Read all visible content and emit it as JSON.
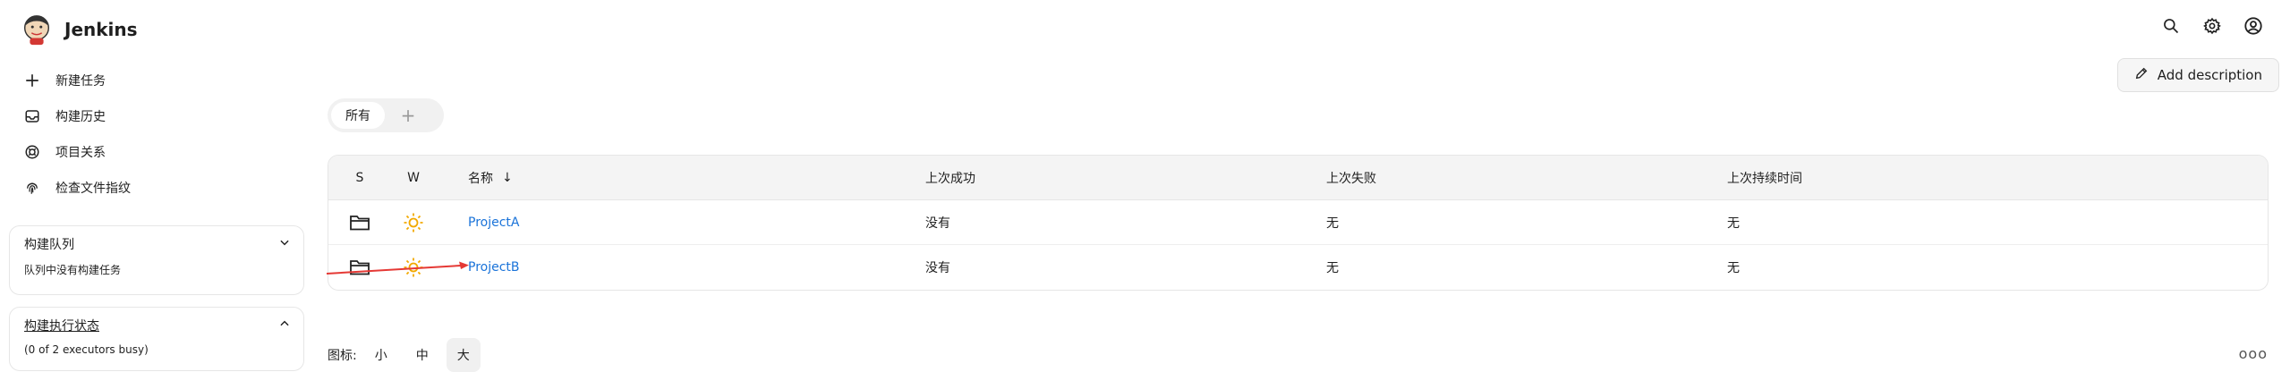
{
  "header": {
    "brand": "Jenkins",
    "icons": [
      "search-icon",
      "gear-icon",
      "user-icon"
    ]
  },
  "sidebar": {
    "tasks": [
      {
        "label": "新建任务",
        "icon": "plus-icon"
      },
      {
        "label": "构建历史",
        "icon": "inbox-icon"
      },
      {
        "label": "项目关系",
        "icon": "relationship-icon"
      },
      {
        "label": "检查文件指纹",
        "icon": "fingerprint-icon"
      }
    ],
    "queue": {
      "title": "构建队列",
      "empty_text": "队列中没有构建任务"
    },
    "executors": {
      "title": "构建执行状态",
      "status": "(0 of 2 executors busy)"
    }
  },
  "main": {
    "add_description": "Add description",
    "tabs": [
      {
        "label": "所有"
      },
      {
        "label": "+"
      }
    ],
    "table": {
      "headers": {
        "s": "S",
        "w": "W",
        "name": "名称",
        "sort_arrow": "↓",
        "last_success": "上次成功",
        "last_failure": "上次失败",
        "last_duration": "上次持续时间"
      },
      "rows": [
        {
          "name": "ProjectA",
          "last_success": "没有",
          "last_failure": "无",
          "last_duration": "无"
        },
        {
          "name": "ProjectB",
          "last_success": "没有",
          "last_failure": "无",
          "last_duration": "无"
        }
      ]
    },
    "icon_size": {
      "label": "图标:",
      "options": [
        "小",
        "中",
        "大"
      ],
      "selected": "大"
    },
    "more": "ooo"
  },
  "colors": {
    "link": "#1a73d9",
    "sun": "#f2a900",
    "arrow": "#e53935"
  }
}
